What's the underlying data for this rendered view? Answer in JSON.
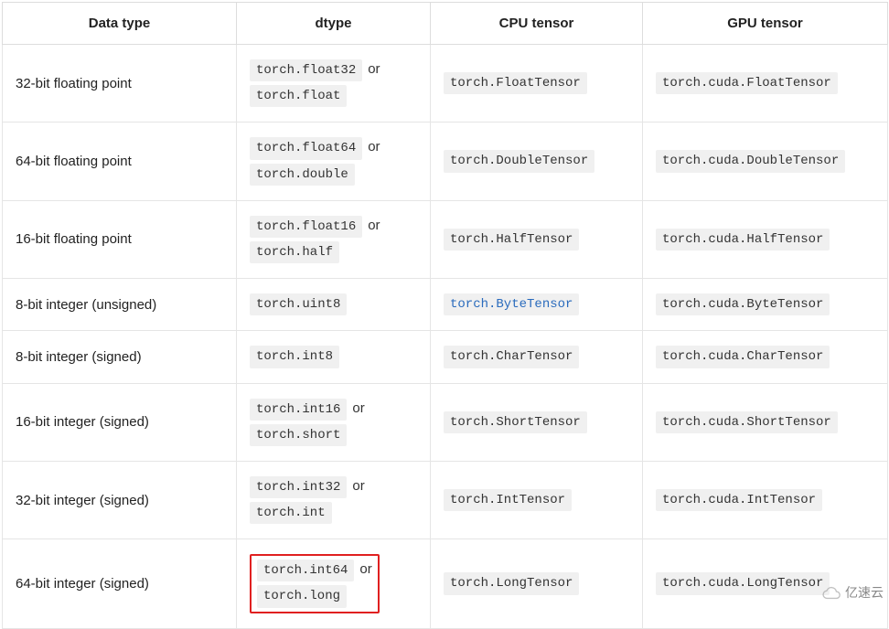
{
  "headers": {
    "data_type": "Data type",
    "dtype": "dtype",
    "cpu": "CPU tensor",
    "gpu": "GPU tensor"
  },
  "or_label": "or",
  "rows": [
    {
      "desc": "32-bit floating point",
      "dtype_a": "torch.float32",
      "dtype_b": "torch.float",
      "cpu": "torch.FloatTensor",
      "gpu": "torch.cuda.FloatTensor",
      "cpu_link": false,
      "highlight": false
    },
    {
      "desc": "64-bit floating point",
      "dtype_a": "torch.float64",
      "dtype_b": "torch.double",
      "cpu": "torch.DoubleTensor",
      "gpu": "torch.cuda.DoubleTensor",
      "cpu_link": false,
      "highlight": false
    },
    {
      "desc": "16-bit floating point",
      "dtype_a": "torch.float16",
      "dtype_b": "torch.half",
      "cpu": "torch.HalfTensor",
      "gpu": "torch.cuda.HalfTensor",
      "cpu_link": false,
      "highlight": false
    },
    {
      "desc": "8-bit integer (unsigned)",
      "dtype_a": "torch.uint8",
      "dtype_b": "",
      "cpu": "torch.ByteTensor",
      "gpu": "torch.cuda.ByteTensor",
      "cpu_link": true,
      "highlight": false
    },
    {
      "desc": "8-bit integer (signed)",
      "dtype_a": "torch.int8",
      "dtype_b": "",
      "cpu": "torch.CharTensor",
      "gpu": "torch.cuda.CharTensor",
      "cpu_link": false,
      "highlight": false
    },
    {
      "desc": "16-bit integer (signed)",
      "dtype_a": "torch.int16",
      "dtype_b": "torch.short",
      "cpu": "torch.ShortTensor",
      "gpu": "torch.cuda.ShortTensor",
      "cpu_link": false,
      "highlight": false
    },
    {
      "desc": "32-bit integer (signed)",
      "dtype_a": "torch.int32",
      "dtype_b": "torch.int",
      "cpu": "torch.IntTensor",
      "gpu": "torch.cuda.IntTensor",
      "cpu_link": false,
      "highlight": false
    },
    {
      "desc": "64-bit integer (signed)",
      "dtype_a": "torch.int64",
      "dtype_b": "torch.long",
      "cpu": "torch.LongTensor",
      "gpu": "torch.cuda.LongTensor",
      "cpu_link": false,
      "highlight": true
    }
  ],
  "watermark": "亿速云"
}
